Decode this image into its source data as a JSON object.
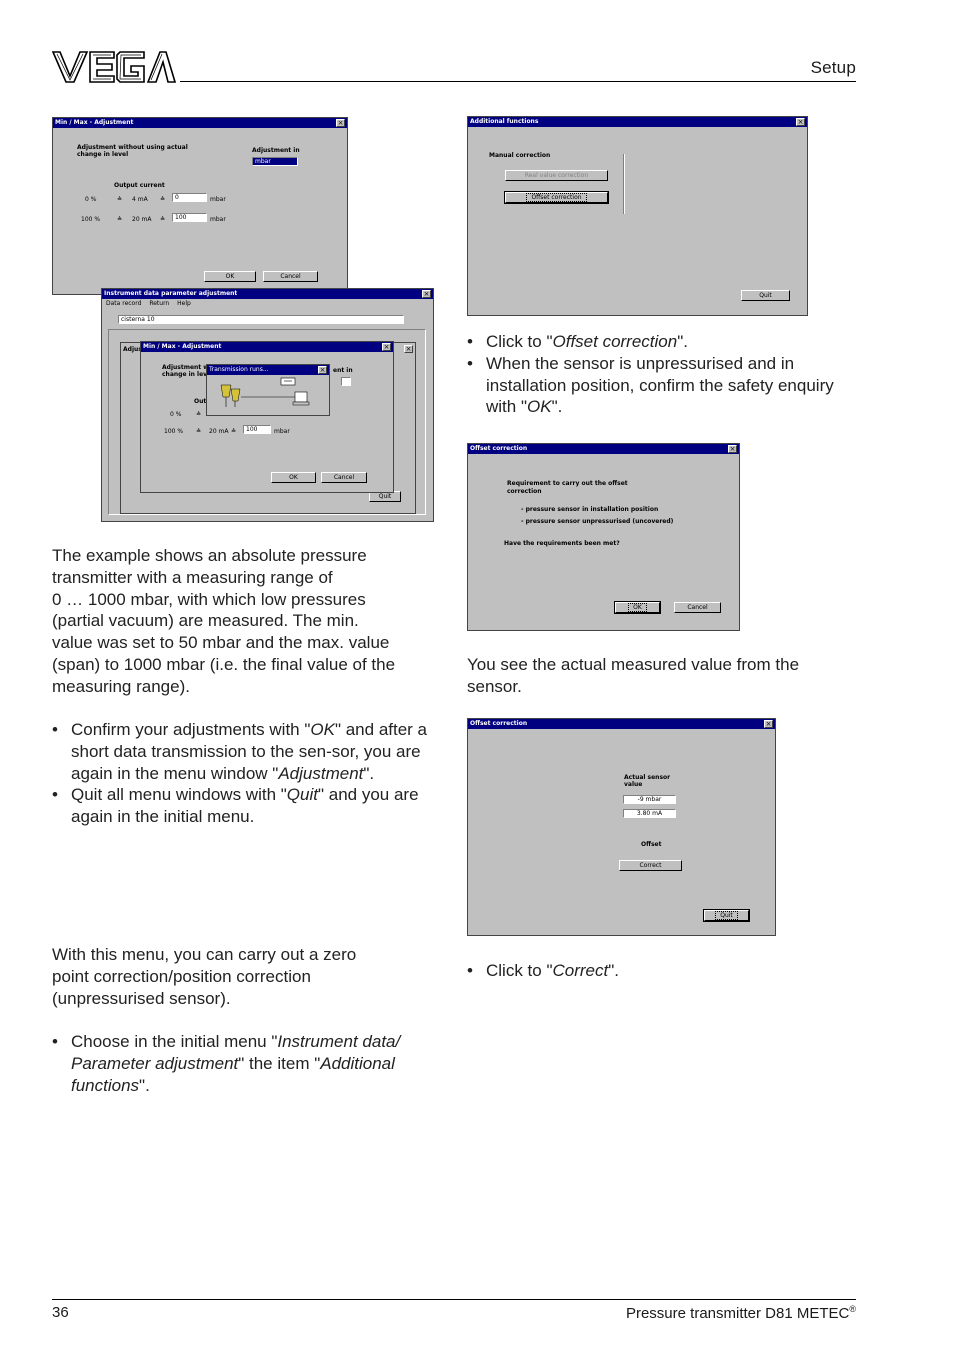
{
  "header": {
    "logo_text": "VEGA",
    "section": "Setup"
  },
  "footer": {
    "page_number": "36",
    "doc_title": "Pressure transmitter D81 METEC",
    "doc_title_mark": "®"
  },
  "left_column": {
    "intro": [
      "The example shows an absolute pressure",
      "transmitter with a measuring range of",
      "0 … 1000 mbar, with which low pressures",
      "(partial vacuum) are measured. The min.",
      "value was set to 50 mbar and the max. value",
      "(span) to 1000 mbar (i.e. the final value of the",
      "measuring range)."
    ],
    "bullets1": [
      {
        "parts": [
          "Confirm your adjustments with \"",
          "OK",
          "\" and after a short data transmission to the sen-sor, you are again in the menu window \"",
          "Adjustment",
          "\"."
        ]
      },
      {
        "parts": [
          "Quit all menu windows with \"",
          "Quit",
          "\" and you are again in the initial menu."
        ]
      }
    ],
    "zero_intro": [
      "With this menu, you can carry out a zero",
      "point correction/position correction",
      "(unpressurised sensor)."
    ],
    "bullets2": [
      {
        "parts": [
          "Choose in the initial menu \"",
          "Instrument data/ Parameter adjustment",
          "\" the item \"",
          "Additional functions",
          "\"."
        ]
      }
    ]
  },
  "right_column": {
    "bullets1": [
      {
        "parts": [
          "Click to \"",
          "Offset correction",
          "\"."
        ]
      },
      {
        "parts": [
          "When the sensor is unpressurised and in installation position, confirm the safety enquiry with \"",
          "OK",
          "\"."
        ]
      }
    ],
    "measured_note": [
      "You see the actual measured value from the",
      "sensor."
    ],
    "bullets2": [
      {
        "parts": [
          "Click to \"",
          "Correct",
          "\"."
        ]
      }
    ]
  },
  "shot_minmax": {
    "title": "Min / Max - Adjustment",
    "note": [
      "Adjustment without using actual",
      "change in level"
    ],
    "adjustment_in_label": "Adjustment in",
    "unit_select": "mbar",
    "output_current_label": "Output current",
    "rows": [
      {
        "pct": "0 %",
        "ma": "4 mA",
        "value": "0",
        "unit": "mbar"
      },
      {
        "pct": "100 %",
        "ma": "20 mA",
        "value": "100",
        "unit": "mbar"
      }
    ],
    "equiv": "≙",
    "ok": "OK",
    "cancel": "Cancel"
  },
  "shot_instrument": {
    "title": "Instrument data parameter adjustment",
    "menu": [
      "Data record",
      "Return",
      "Help"
    ],
    "record": "cisterna 10",
    "inner_adj_title": "Adjus",
    "inner_title": "Min / Max - Adjustment",
    "inner_note": [
      "Adjustment with",
      "change in leve"
    ],
    "inner_side": "ent in",
    "inner_out": "Outp",
    "inner_rows": [
      {
        "pct": "0 %",
        "ma": "",
        "value": ""
      },
      {
        "pct": "100 %",
        "ma": "20 mA",
        "value": "100",
        "unit": "mbar"
      }
    ],
    "equiv": "≙",
    "transmission_title": "Transmission runs...",
    "ok": "OK",
    "cancel": "Cancel",
    "quit": "Quit"
  },
  "shot_additional": {
    "title": "Additional functions",
    "section": "Manual correction",
    "real_value_btn": "Real value correction",
    "offset_btn": "Offset correction",
    "quit": "Quit"
  },
  "shot_offset1": {
    "title": "Offset correction",
    "req": [
      "Requirement to carry out the offset",
      "correction"
    ],
    "items": [
      "- pressure sensor in installation position",
      "- pressure sensor unpressurised (uncovered)"
    ],
    "question": "Have the requirements been met?",
    "ok": "OK",
    "cancel": "Cancel"
  },
  "shot_offset2": {
    "title": "Offset correction",
    "actual": [
      "Actual sensor",
      "value"
    ],
    "v1": "-9 mbar",
    "v2": "3.80 mA",
    "offset_label": "Offset",
    "correct": "Correct",
    "quit": "Quit"
  }
}
